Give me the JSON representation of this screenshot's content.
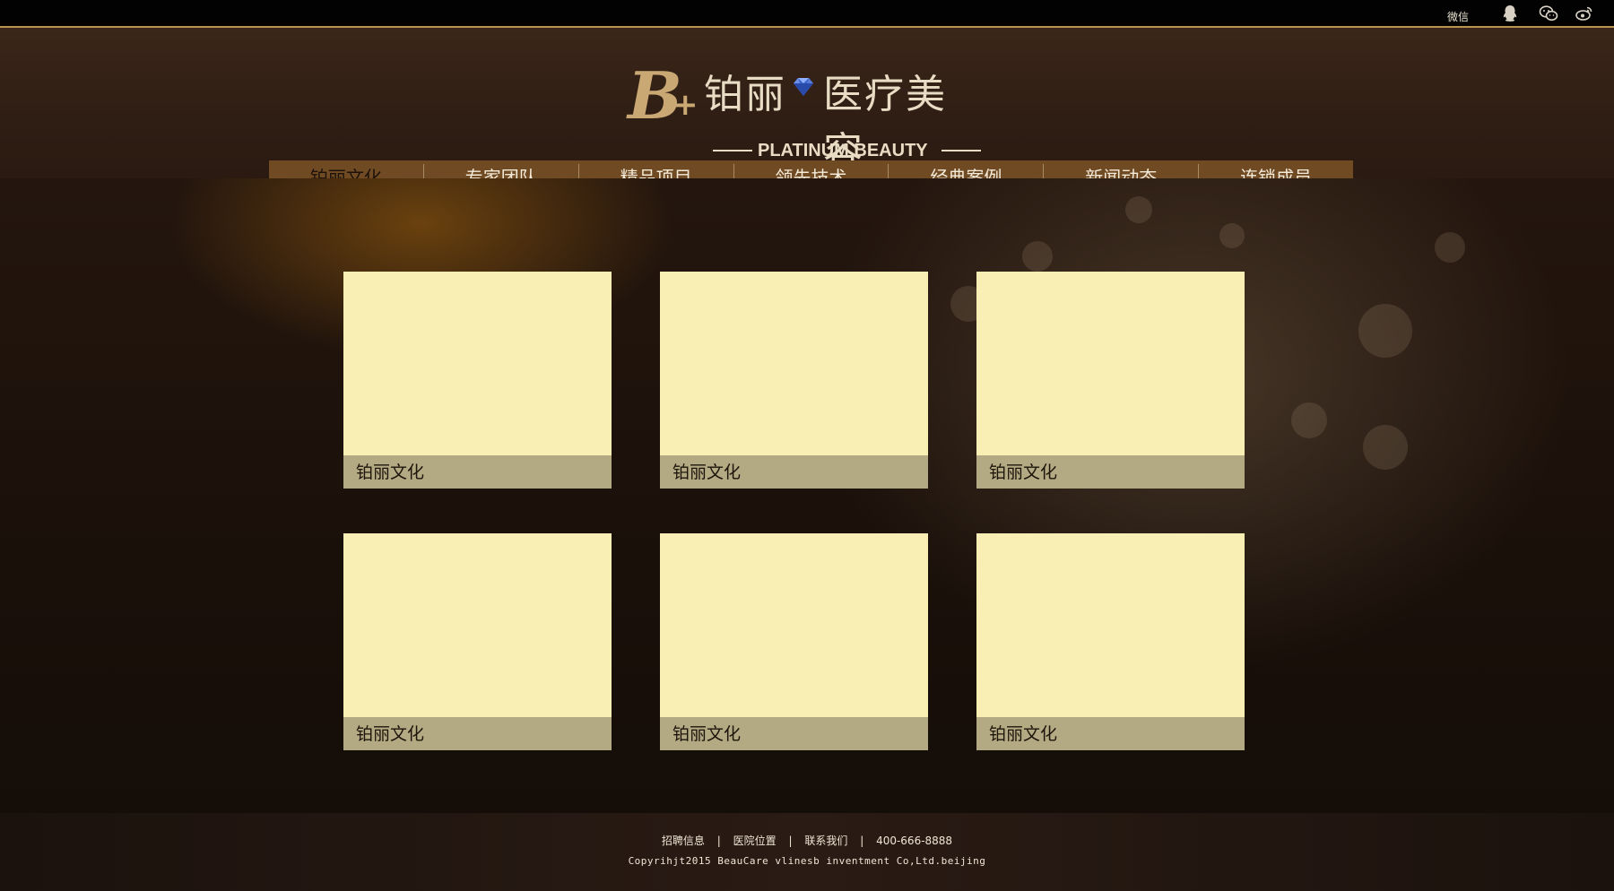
{
  "topbar": {
    "wechat_label": "微信",
    "icons": [
      "qq-icon",
      "wechat-icon",
      "weibo-icon"
    ]
  },
  "logo": {
    "mark_b": "B",
    "mark_plus": "+",
    "name_cn_1": "铂丽",
    "name_cn_2": "医疗美容",
    "name_en": "PLATINUM BEAUTY"
  },
  "nav": {
    "items": [
      {
        "label": "铂丽文化"
      },
      {
        "label": "专家团队"
      },
      {
        "label": "精品项目"
      },
      {
        "label": "领先技术"
      },
      {
        "label": "经典案例"
      },
      {
        "label": "新闻动态"
      },
      {
        "label": "连锁成员"
      }
    ],
    "active_index": 0
  },
  "cards": [
    {
      "caption": "铂丽文化"
    },
    {
      "caption": "铂丽文化"
    },
    {
      "caption": "铂丽文化"
    },
    {
      "caption": "铂丽文化"
    },
    {
      "caption": "铂丽文化"
    },
    {
      "caption": "铂丽文化"
    }
  ],
  "footer": {
    "links": [
      "招聘信息",
      "医院位置",
      "联系我们",
      "400-666-8888"
    ],
    "separator": "|",
    "copyright": "Copyrihjt2015 BeauCare vlinesb invent­ment Co,Ltd.beijing"
  },
  "colors": {
    "accent_gold": "#c9a874",
    "nav_bg": "#6f4a23",
    "card_bg": "#f9efb5",
    "caption_bg": "#b3a982"
  }
}
